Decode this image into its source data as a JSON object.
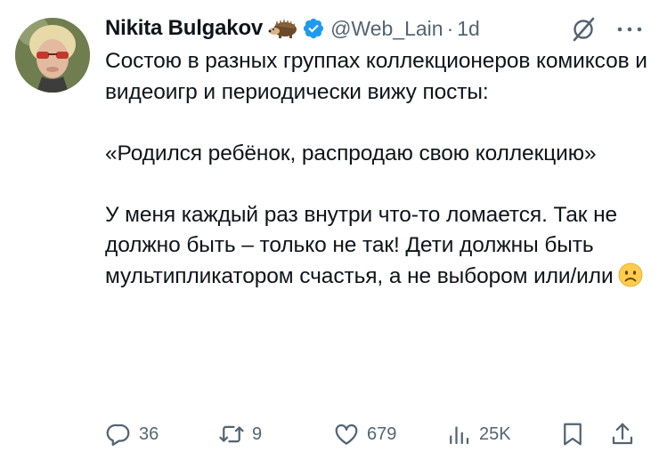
{
  "author": {
    "name": "Nikita Bulgakov",
    "name_emoji": "hedgehog-emoji",
    "verified": true,
    "handle": "@Web_Lain",
    "separator": "·",
    "time": "1d"
  },
  "tweet": {
    "paragraphs": [
      "Состою в разных группах коллекционеров комиксов и видеоигр и периодически вижу посты:",
      "«Родился ребёнок, распродаю свою коллекцию»",
      "У меня каждый раз внутри что-то ломается. Так не должно быть – только не так! Дети должны быть мультипликатором счастья, а не выбором или/или"
    ],
    "trailing_emoji": "slightly-frowning-face-emoji"
  },
  "actions": {
    "replies": "36",
    "retweets": "9",
    "likes": "679",
    "views": "25K"
  },
  "colors": {
    "text": "#0f1419",
    "muted": "#536471",
    "verified_blue": "#1d9bf0"
  }
}
